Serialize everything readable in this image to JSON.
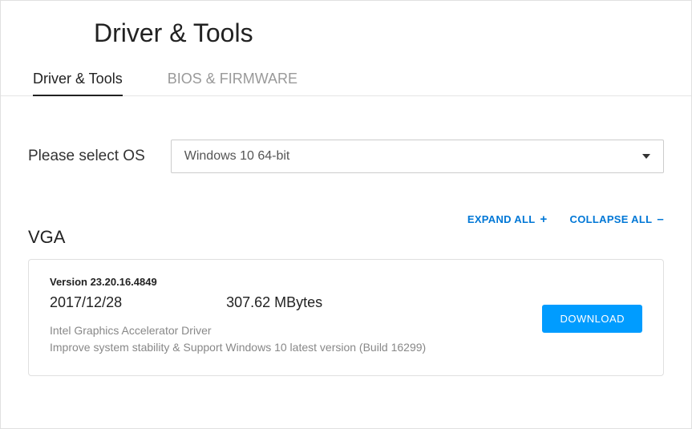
{
  "pageTitle": "Driver & Tools",
  "tabs": [
    {
      "label": "Driver & Tools",
      "active": true
    },
    {
      "label": "BIOS & FIRMWARE",
      "active": false
    }
  ],
  "osSelector": {
    "label": "Please select OS",
    "selected": "Windows 10 64-bit"
  },
  "actions": {
    "expandAll": "EXPAND ALL",
    "collapseAll": "COLLAPSE ALL"
  },
  "section": {
    "title": "VGA",
    "driver": {
      "versionLabel": "Version 23.20.16.4849",
      "date": "2017/12/28",
      "size": "307.62 MBytes",
      "name": "Intel Graphics Accelerator Driver",
      "description": "Improve system stability & Support Windows 10 latest version (Build 16299)",
      "downloadLabel": "DOWNLOAD"
    }
  }
}
